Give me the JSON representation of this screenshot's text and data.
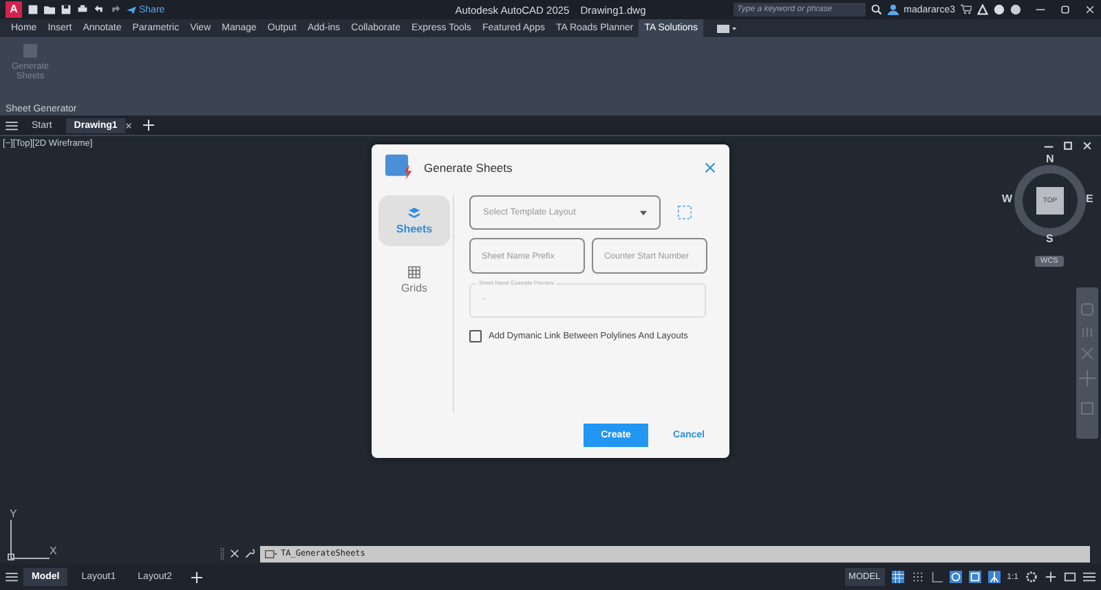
{
  "title_bar": {
    "app_menu": "A",
    "share": "Share",
    "title": "Autodesk AutoCAD 2025",
    "file": "Drawing1.dwg",
    "search_placeholder": "Type a keyword or phrase",
    "user": "madararce3"
  },
  "ribbon_tabs": [
    {
      "label": "Home",
      "selected": false
    },
    {
      "label": "Insert",
      "selected": false
    },
    {
      "label": "Annotate",
      "selected": false
    },
    {
      "label": "Parametric",
      "selected": false
    },
    {
      "label": "View",
      "selected": false
    },
    {
      "label": "Manage",
      "selected": false
    },
    {
      "label": "Output",
      "selected": false
    },
    {
      "label": "Add-ins",
      "selected": false
    },
    {
      "label": "Collaborate",
      "selected": false
    },
    {
      "label": "Express Tools",
      "selected": false
    },
    {
      "label": "Featured Apps",
      "selected": false
    },
    {
      "label": "TA Roads Planner",
      "selected": false
    },
    {
      "label": "TA Solutions",
      "selected": true
    }
  ],
  "ribbon_panel": {
    "button": {
      "label": "Generate Sheets",
      "disabled": true
    },
    "panel_label": "Sheet Generator"
  },
  "file_tabs": [
    {
      "label": "Start",
      "selected": false
    },
    {
      "label": "Drawing1",
      "selected": true
    }
  ],
  "viewport_label": "[−][Top][2D Wireframe]",
  "viewcube": {
    "north": "N",
    "south": "S",
    "east": "E",
    "west": "W",
    "face": "TOP",
    "ucs": "WCS"
  },
  "dialog": {
    "title": "Generate Sheets",
    "side_tabs": [
      {
        "label": "Sheets",
        "kind": "sheets",
        "selected": true
      },
      {
        "label": "Grids",
        "kind": "grids",
        "selected": false
      }
    ],
    "template_select": {
      "placeholder": "Select Template Layout"
    },
    "prefix_field": {
      "placeholder": "Sheet Name Prefix"
    },
    "counter_field": {
      "placeholder": "Counter Start Number"
    },
    "preview": {
      "label": "Sheet Name Example Preview",
      "value": "-"
    },
    "checkbox": {
      "label": "Add Dymanic Link Between Polylines And Layouts",
      "checked": false
    },
    "create": "Create",
    "cancel": "Cancel"
  },
  "ucs_icon": {
    "x": "X",
    "y": "Y"
  },
  "command_line": "TA_GenerateSheets",
  "layout_tabs": [
    {
      "label": "Model",
      "selected": true
    },
    {
      "label": "Layout1",
      "selected": false
    },
    {
      "label": "Layout2",
      "selected": false
    }
  ],
  "status_bar": {
    "space": "MODEL",
    "scale": "1:1"
  }
}
